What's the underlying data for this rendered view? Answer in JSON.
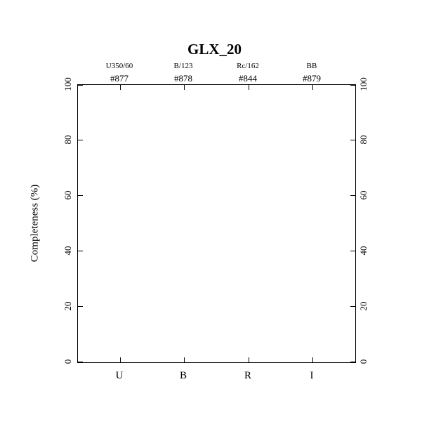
{
  "chart_data": {
    "type": "bar",
    "title": "GLX_20",
    "ylabel": "Completeness (%)",
    "xlabel": "",
    "ylim": [
      0,
      100
    ],
    "categories": [
      "U",
      "B",
      "R",
      "I"
    ],
    "values": [
      null,
      null,
      null,
      null
    ],
    "yticks": [
      0,
      20,
      40,
      60,
      80,
      100
    ],
    "annotations": {
      "top_row1": [
        "U350/60",
        "B/123",
        "Rc/162",
        "BB"
      ],
      "top_row2": [
        "#877",
        "#878",
        "#844",
        "#879"
      ]
    }
  }
}
